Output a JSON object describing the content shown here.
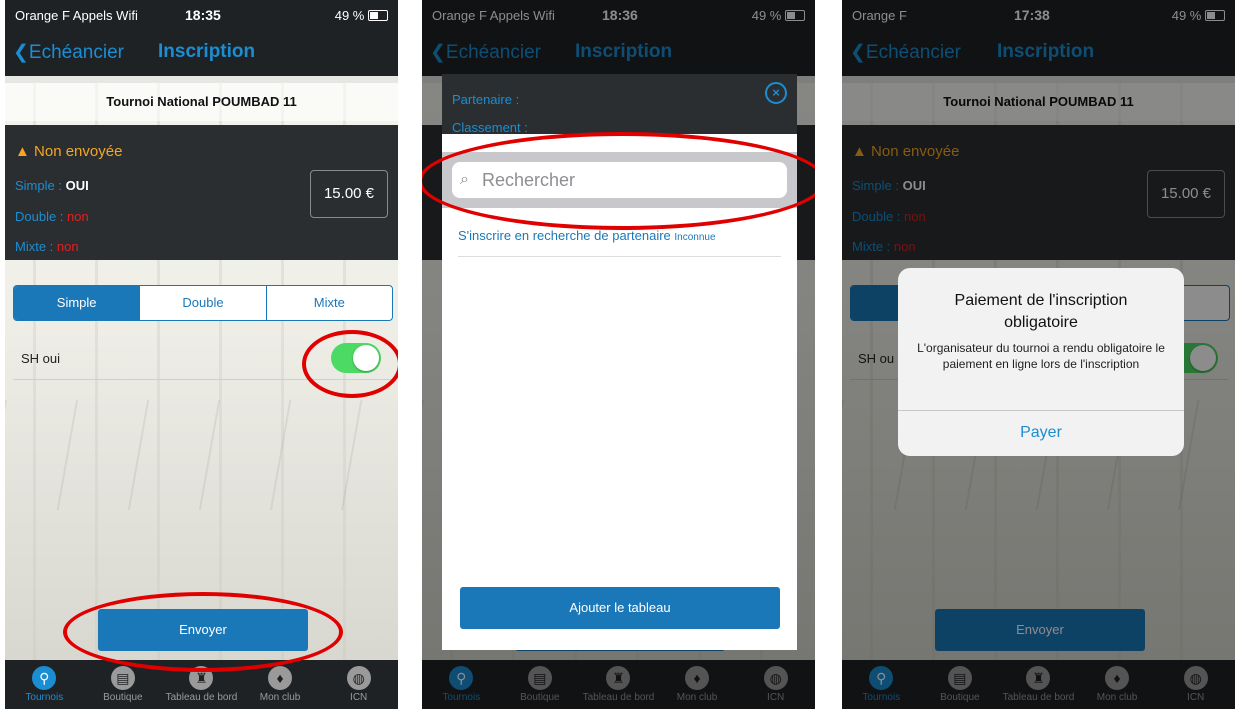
{
  "phone1": {
    "status": {
      "carrier": "Orange F Appels Wifi",
      "time": "18:35",
      "battery": "49 %"
    },
    "nav": {
      "back": "Echéancier",
      "title": "Inscription"
    },
    "tournament": "Tournoi National POUMBAD 11",
    "panel": {
      "status": "Non envoyée",
      "simple_label": "Simple : ",
      "simple_value": "OUI",
      "double_label": "Double : ",
      "double_value": "non",
      "mixte_label": "Mixte : ",
      "mixte_value": "non",
      "price": "15.00 €"
    },
    "tabs": [
      "Simple",
      "Double",
      "Mixte"
    ],
    "toggle_label": "SH oui",
    "send": "Envoyer"
  },
  "phone2": {
    "status": {
      "carrier": "Orange F Appels Wifi",
      "time": "18:36",
      "battery": "49 %"
    },
    "nav": {
      "back": "Echéancier",
      "title": "Inscription"
    },
    "modal": {
      "partner_label": "Partenaire :",
      "ranking_label": "Classement :",
      "search_placeholder": "Rechercher",
      "result": "S'inscrire en recherche de partenaire",
      "result_tag": "Inconnue",
      "add_button": "Ajouter le tableau"
    }
  },
  "phone3": {
    "status": {
      "carrier": "Orange F",
      "time": "17:38",
      "battery": "49 %"
    },
    "nav": {
      "back": "Echéancier",
      "title": "Inscription"
    },
    "tournament": "Tournoi National POUMBAD 11",
    "panel": {
      "status": "Non envoyée",
      "simple_label": "Simple : ",
      "simple_value": "OUI",
      "double_label": "Double : ",
      "double_value": "non",
      "mixte_label": "Mixte : ",
      "mixte_value": "non",
      "price": "15.00 €"
    },
    "toggle_label": "SH ou",
    "send": "Envoyer",
    "alert": {
      "title": "Paiement de l'inscription obligatoire",
      "message": "L'organisateur du tournoi a rendu obligatoire le paiement en ligne lors de l'inscription",
      "action": "Payer"
    }
  },
  "tabbar": [
    "Tournois",
    "Boutique",
    "Tableau de bord",
    "Mon club",
    "ICN"
  ],
  "colors": {
    "accent": "#1b8ed3",
    "button": "#1b78b8",
    "warning": "#f5a623",
    "error": "#e02020",
    "toggle_on": "#4cd964",
    "highlight_circle": "#e00000"
  }
}
